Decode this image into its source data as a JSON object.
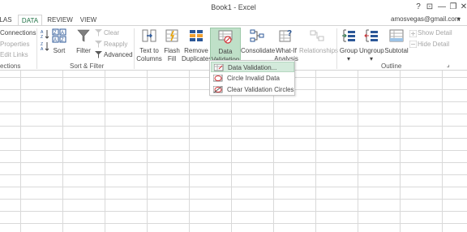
{
  "window": {
    "title": "Book1 - Excel",
    "help": "?",
    "ribbon_opts": "⊡",
    "minimize": "—",
    "restore": "❐",
    "close": "✕"
  },
  "tabs": [
    {
      "label": "LAS",
      "active": false
    },
    {
      "label": "DATA",
      "active": true
    },
    {
      "label": "REVIEW",
      "active": false
    },
    {
      "label": "VIEW",
      "active": false
    }
  ],
  "user": {
    "email": "amosvegas@gmail.com",
    "caret": "▾"
  },
  "ribbon": {
    "connections_group": {
      "items": [
        "Connections",
        "Properties",
        "Edit Links"
      ],
      "label": "ections"
    },
    "sort_filter": {
      "sort": "Sort",
      "filter": "Filter",
      "clear": "Clear",
      "reapply": "Reapply",
      "advanced": "Advanced",
      "label": "Sort & Filter"
    },
    "data_tools": {
      "text_to_columns": [
        "Text to",
        "Columns"
      ],
      "flash_fill": [
        "Flash",
        "Fill"
      ],
      "remove_duplicates": [
        "Remove",
        "Duplicates"
      ],
      "data_validation": [
        "Data",
        "Validation"
      ],
      "data_validation_caret": "▾",
      "consolidate": "Consolidate",
      "what_if": [
        "What-If",
        "Analysis"
      ],
      "what_if_caret": "▾",
      "relationships": "Relationships"
    },
    "outline": {
      "group": "Group",
      "ungroup": "Ungroup",
      "subtotal": "Subtotal",
      "caret": "▾",
      "show_detail": "Show Detail",
      "hide_detail": "Hide Detail",
      "label": "Outline",
      "launcher": "⌟"
    }
  },
  "dropdown": {
    "items": [
      {
        "label": "Data Validation...",
        "icon": "data-validation-icon"
      },
      {
        "label": "Circle Invalid Data",
        "icon": "circle-invalid-icon"
      },
      {
        "label": "Clear Validation Circles",
        "icon": "clear-circles-icon"
      }
    ]
  },
  "colors": {
    "accent": "#217346",
    "pressed": "#bfe0c8",
    "hover": "#d3eadb",
    "gridline": "#d9d9d9"
  }
}
